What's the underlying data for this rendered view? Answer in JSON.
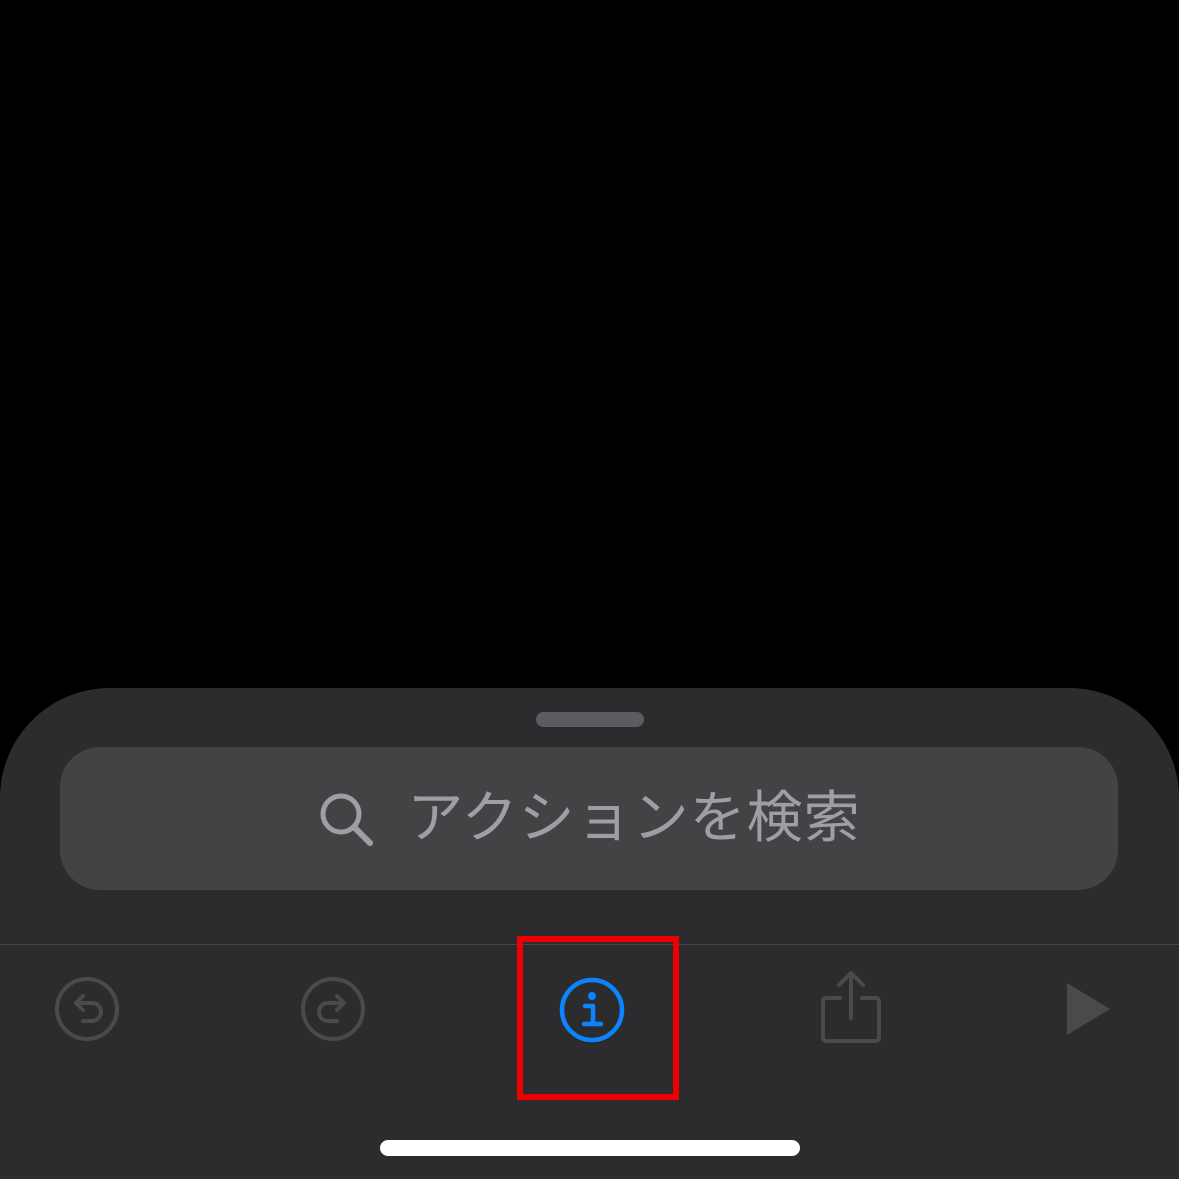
{
  "search": {
    "placeholder": "アクションを検索",
    "icon": "search-icon"
  },
  "toolbar": {
    "items": [
      {
        "name": "undo",
        "icon": "undo-icon",
        "enabled": false
      },
      {
        "name": "redo",
        "icon": "redo-icon",
        "enabled": false
      },
      {
        "name": "info",
        "icon": "info-icon",
        "enabled": true,
        "highlighted": true
      },
      {
        "name": "share",
        "icon": "share-icon",
        "enabled": false
      },
      {
        "name": "run",
        "icon": "play-icon",
        "enabled": false
      }
    ]
  },
  "colors": {
    "background": "#000000",
    "sheet": "#2c2c2e",
    "search_field": "#434346",
    "placeholder_text": "#9e9ea3",
    "disabled_icon": "#4a4a4d",
    "accent": "#0a84ff",
    "highlight": "#ef0000"
  }
}
